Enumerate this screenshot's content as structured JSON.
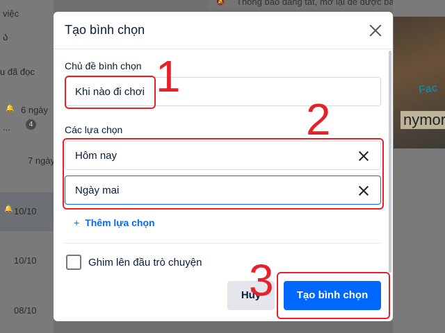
{
  "background": {
    "left_texts": [
      "việc",
      "u đã đọc",
      "6 ngày",
      "...",
      "7 ngày",
      "10/10",
      "10/10",
      "08/10"
    ],
    "unread_badge": "4",
    "top_notice": "Thông báo đang tắt, mở lại để được báo tin nhắn",
    "media_text_1": "Fac",
    "media_text_2": "nymor"
  },
  "dialog": {
    "title": "Tạo bình chọn",
    "topic_label": "Chủ đề bình chọn",
    "topic_value": "Khi nào đi chơi",
    "options_label": "Các lựa chọn",
    "options": [
      "Hôm nay",
      "Ngày mai"
    ],
    "add_option": "Thêm lựa chọn",
    "add_option_icon": "+",
    "pin_label": "Ghim lên đầu trò chuyện",
    "cancel_label": "Hủy",
    "create_label": "Tạo bình chọn"
  },
  "annotations": [
    "1",
    "2",
    "3"
  ],
  "colors": {
    "accent": "#0068ff",
    "annotation": "#e8202a",
    "overlay": "#6f6f6f"
  }
}
